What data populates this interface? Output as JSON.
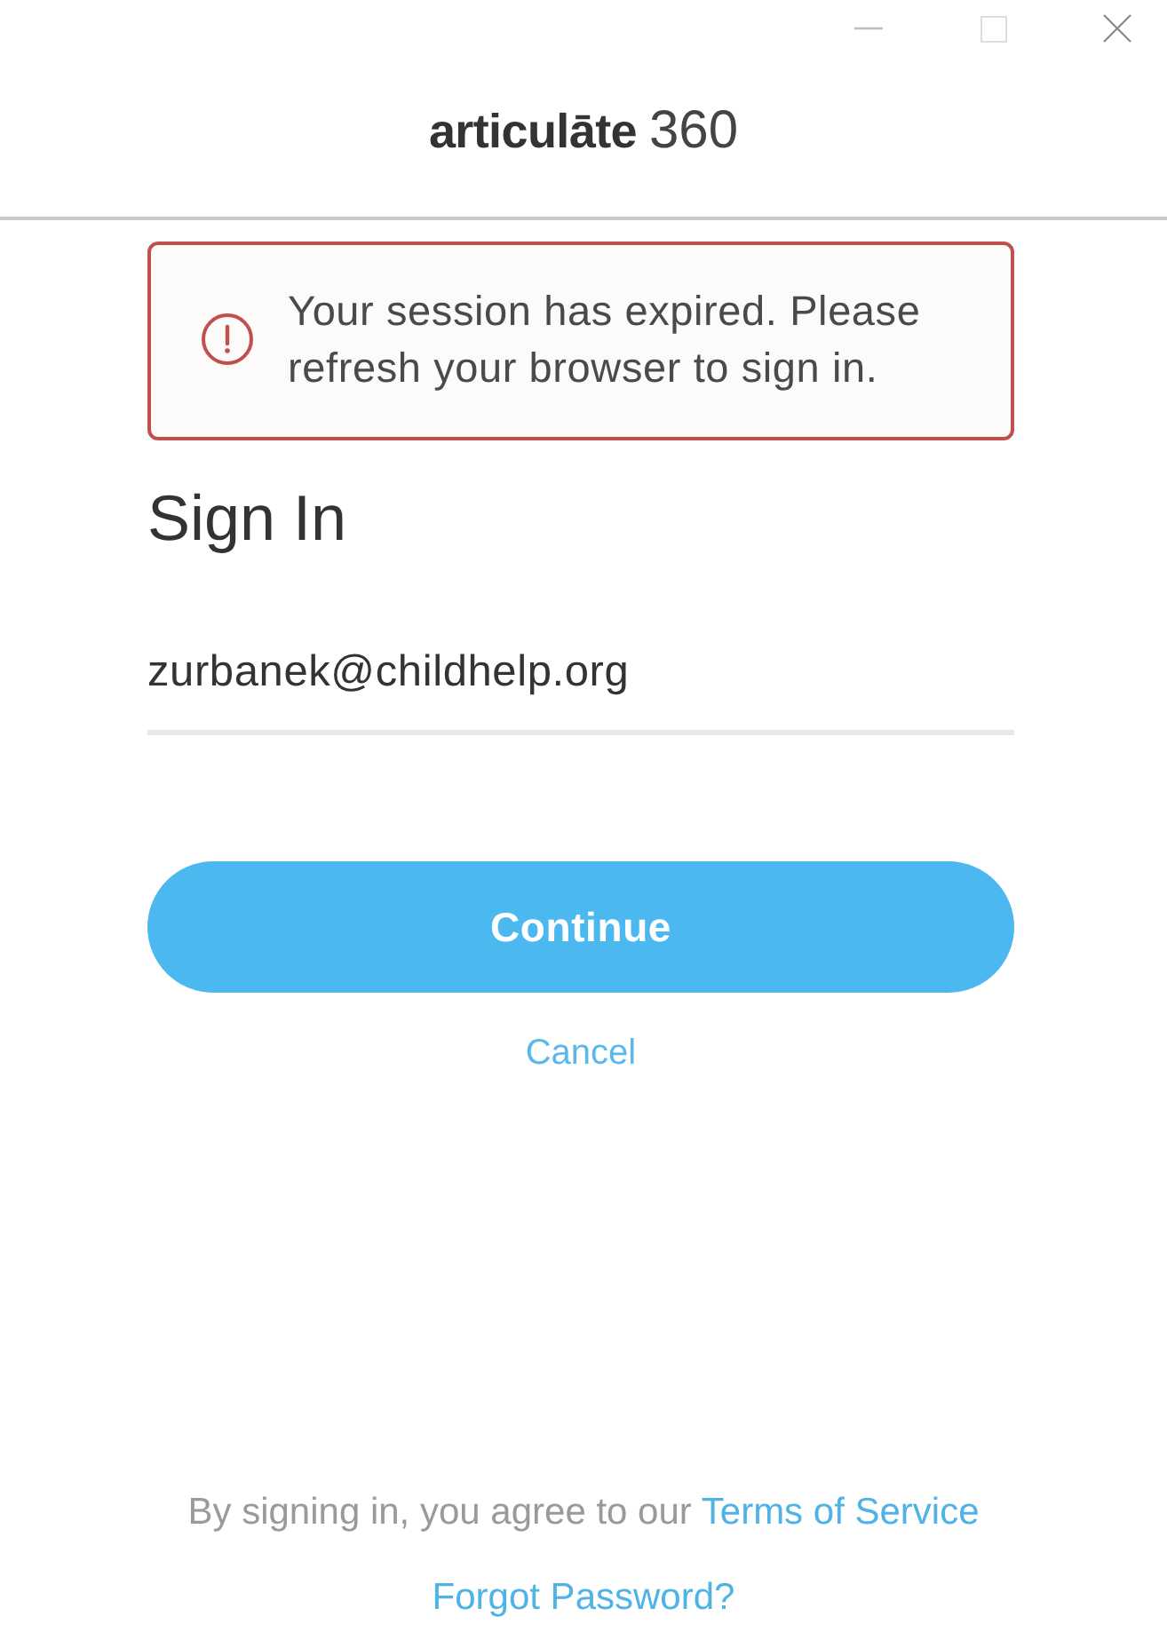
{
  "logo": {
    "word": "articulāte",
    "number": "360"
  },
  "alert": {
    "message": "Your session has expired. Please refresh your browser to sign in."
  },
  "sign_in": {
    "heading": "Sign In",
    "email_field": {
      "value": "zurbanek@childhelp.org"
    },
    "continue_button": "Continue",
    "cancel_link": "Cancel"
  },
  "footer": {
    "agreement": {
      "text": "By signing in, you agree to our",
      "link": "Terms of Service"
    },
    "forgot_password_link": "Forgot Password?"
  }
}
